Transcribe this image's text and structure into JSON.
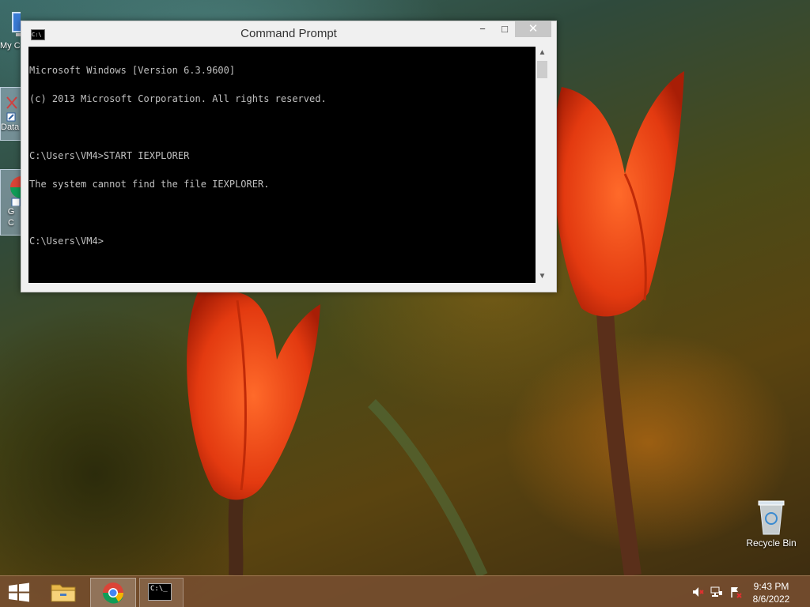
{
  "window": {
    "title": "Command Prompt",
    "console_lines": [
      "Microsoft Windows [Version 6.3.9600]",
      "(c) 2013 Microsoft Corporation. All rights reserved.",
      "",
      "C:\\Users\\VM4>START IEXPLORER",
      "The system cannot find the file IEXPLORER.",
      "",
      "C:\\Users\\VM4>"
    ],
    "icon_text": "C:\\",
    "buttons": {
      "minimize": "−",
      "maximize": "□",
      "close": "✕"
    }
  },
  "desktop": {
    "icons": [
      {
        "label": "My C",
        "icon": "computer-icon"
      },
      {
        "label": "Data",
        "icon": "shortcut-icon"
      },
      {
        "label": "G\nC",
        "icon": "chrome-shortcut-icon"
      },
      {
        "label": "Recycle Bin",
        "icon": "recycle-bin-icon"
      }
    ]
  },
  "taskbar": {
    "items": [
      {
        "name": "start",
        "icon": "windows-logo-icon"
      },
      {
        "name": "file-explorer",
        "icon": "folder-icon"
      },
      {
        "name": "chrome",
        "icon": "chrome-icon"
      },
      {
        "name": "command-prompt",
        "icon": "cmd-icon"
      }
    ],
    "cmd_icon_text": "C:\\_",
    "tray": [
      "volume-muted-icon",
      "network-icon",
      "action-center-icon"
    ],
    "clock": {
      "time": "9:43 PM",
      "date": "8/6/2022"
    }
  },
  "colors": {
    "console_bg": "#000000",
    "console_fg": "#c0c0c0",
    "taskbar": "#784e30",
    "close_button": "#c7c7c7"
  }
}
